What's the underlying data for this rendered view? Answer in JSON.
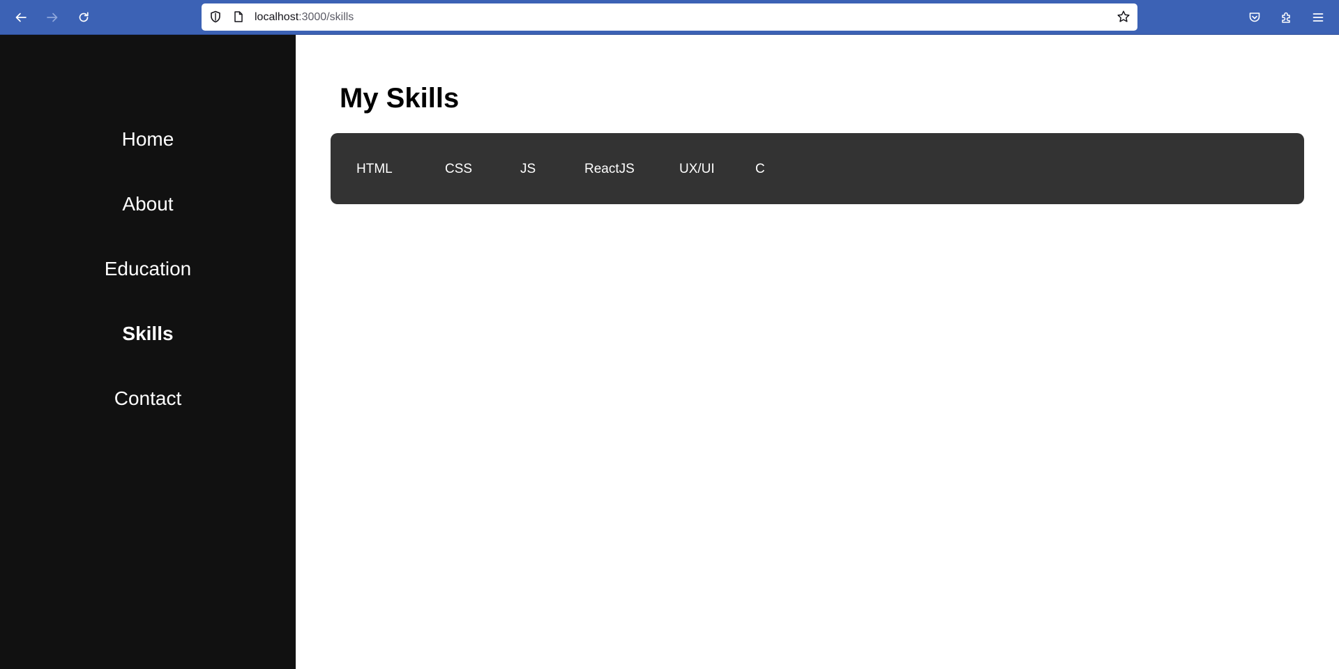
{
  "browser": {
    "url_host": "localhost",
    "url_path": ":3000/skills",
    "icons": {
      "back": "arrow-left-icon",
      "forward": "arrow-right-icon",
      "reload": "reload-icon",
      "tracking_protection": "shield-icon",
      "page_info": "page-icon",
      "bookmark": "star-icon",
      "pocket": "pocket-icon",
      "extensions": "puzzle-icon",
      "menu": "hamburger-menu-icon"
    },
    "colors": {
      "toolbar": "#3c62b5",
      "urlbar": "#ffffff"
    }
  },
  "sidebar": {
    "background": "#111111",
    "items": [
      {
        "label": "Home",
        "active": false
      },
      {
        "label": "About",
        "active": false
      },
      {
        "label": "Education",
        "active": false
      },
      {
        "label": "Skills",
        "active": true
      },
      {
        "label": "Contact",
        "active": false
      }
    ]
  },
  "main": {
    "title": "My Skills",
    "skills_panel_color": "#333333",
    "skills": [
      {
        "label": "HTML"
      },
      {
        "label": "CSS"
      },
      {
        "label": "JS"
      },
      {
        "label": "ReactJS"
      },
      {
        "label": "UX/UI"
      },
      {
        "label": "C"
      }
    ]
  }
}
